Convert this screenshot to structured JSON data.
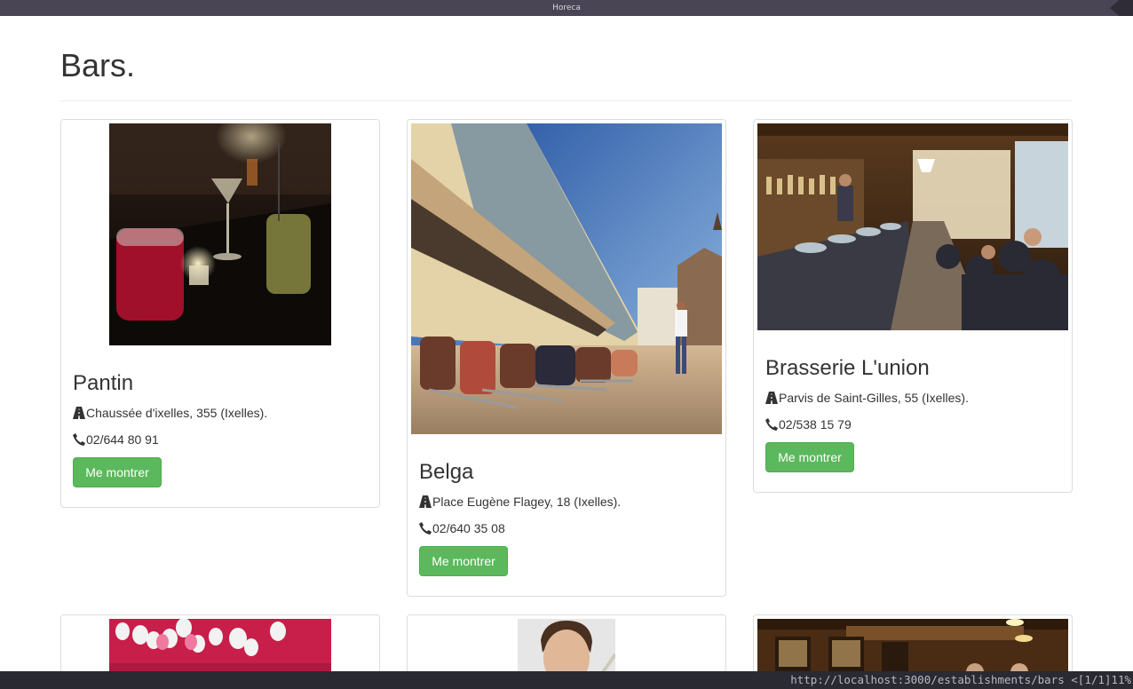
{
  "window": {
    "title": "Horeca"
  },
  "page": {
    "heading": "Bars."
  },
  "cards": [
    {
      "name": "Pantin",
      "address": "Chaussée d'ixelles, 355 (Ixelles).",
      "phone": "02/644 80 91",
      "button": "Me montrer"
    },
    {
      "name": "Belga",
      "address": "Place Eugène Flagey, 18 (Ixelles).",
      "phone": "02/640 35 08",
      "button": "Me montrer"
    },
    {
      "name": "Brasserie L'union",
      "address": "Parvis de Saint-Gilles, 55 (Ixelles).",
      "phone": "02/538 15 79",
      "button": "Me montrer"
    }
  ],
  "statusbar": {
    "text": "http://localhost:3000/establishments/bars <[1/1]11%"
  },
  "colors": {
    "button": "#5cb85c",
    "titlebar": "#4a4555",
    "statusbar": "#2a2a33"
  }
}
